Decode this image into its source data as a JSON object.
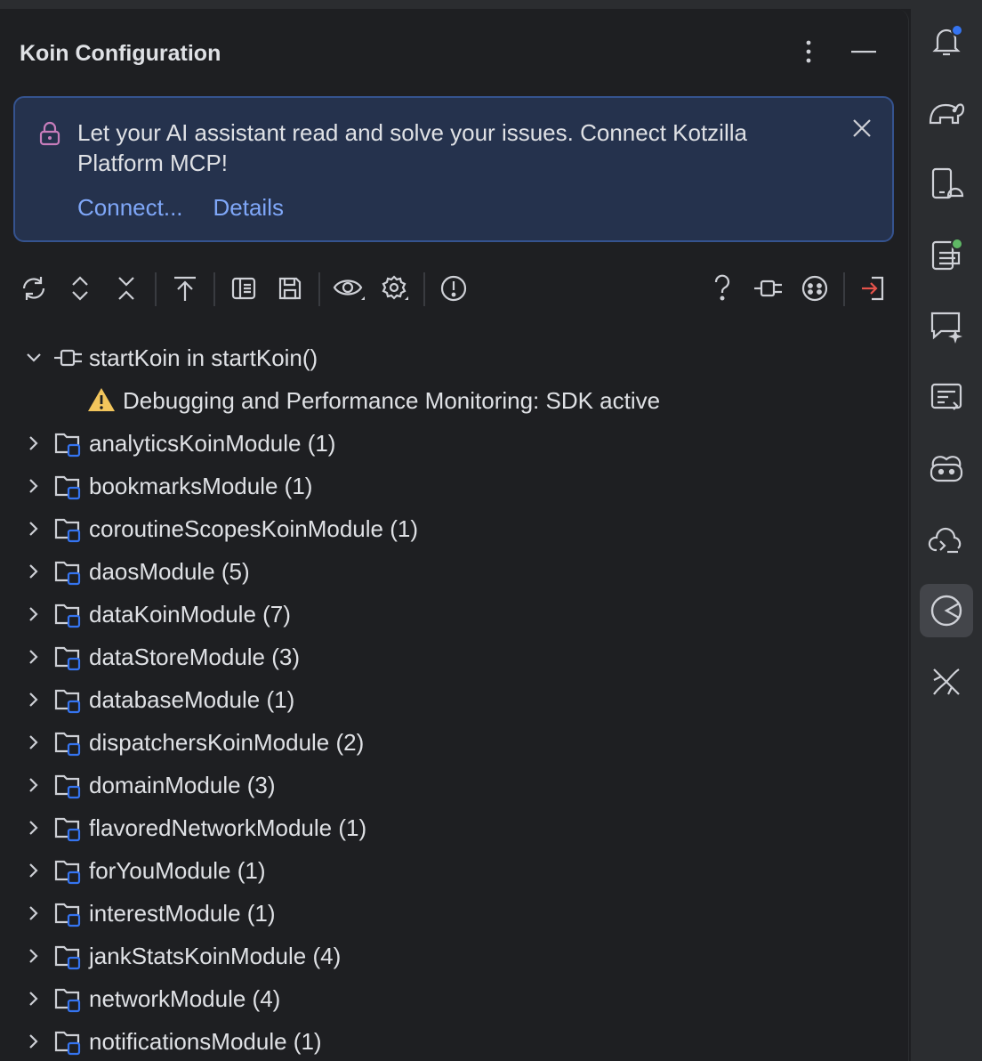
{
  "panel": {
    "title": "Koin Configuration"
  },
  "banner": {
    "text": "Let your AI assistant read and solve your issues. Connect Kotzilla Platform MCP!",
    "links": [
      "Connect...",
      "Details"
    ]
  },
  "toolbar": {
    "left_icons": [
      "refresh-icon",
      "expand-all-icon",
      "collapse-all-icon",
      "export-icon",
      "panel-icon",
      "save-icon",
      "view-options-icon",
      "settings-icon",
      "issues-icon"
    ],
    "right_icons": [
      "help-icon",
      "plug-icon",
      "face-icon",
      "logout-icon"
    ]
  },
  "tree": {
    "root": {
      "label": "startKoin in startKoin()"
    },
    "warning": {
      "label": "Debugging and Performance Monitoring: SDK active"
    },
    "modules": [
      {
        "label": "analyticsKoinModule (1)"
      },
      {
        "label": "bookmarksModule (1)"
      },
      {
        "label": "coroutineScopesKoinModule (1)"
      },
      {
        "label": "daosModule (5)"
      },
      {
        "label": "dataKoinModule (7)"
      },
      {
        "label": "dataStoreModule (3)"
      },
      {
        "label": "databaseModule (1)"
      },
      {
        "label": "dispatchersKoinModule (2)"
      },
      {
        "label": "domainModule (3)"
      },
      {
        "label": "flavoredNetworkModule (1)"
      },
      {
        "label": "forYouModule (1)"
      },
      {
        "label": "interestModule (1)"
      },
      {
        "label": "jankStatsKoinModule (4)"
      },
      {
        "label": "networkModule (4)"
      },
      {
        "label": "notificationsModule (1)"
      }
    ]
  },
  "sidebar": {
    "icons": [
      "notifications-icon",
      "gradle-elephant-icon",
      "device-manager-icon",
      "running-devices-icon",
      "ai-chat-icon",
      "logcat-icon",
      "copilot-icon",
      "cloud-terminal-icon",
      "koin-icon",
      "plane-icon"
    ],
    "active": "koin-icon"
  },
  "colors": {
    "background": "#1e1f22",
    "sidebar": "#2b2d30",
    "banner_bg": "#25324d",
    "banner_border": "#35538f",
    "link": "#7fa7f8",
    "warning": "#f2c55c",
    "badge_blue": "#3574f0",
    "badge_green": "#5fb865",
    "lock_pink": "#c77dbb"
  }
}
